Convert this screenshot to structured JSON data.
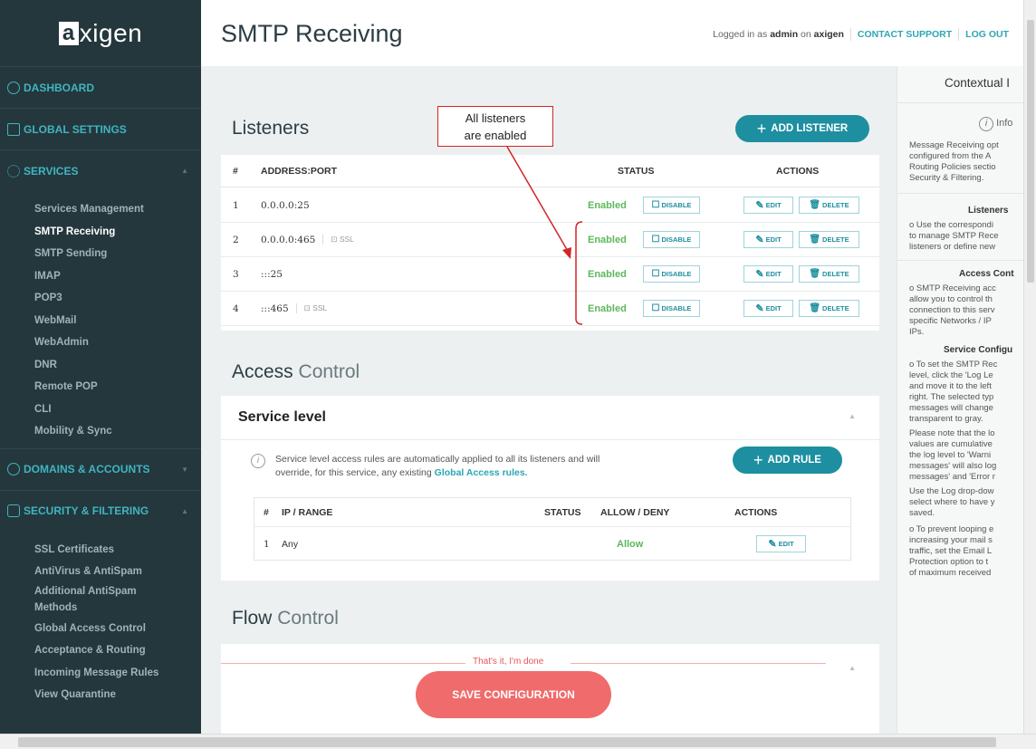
{
  "app": {
    "logo_box": "a",
    "logo_rest": "xigen"
  },
  "header": {
    "title": "SMTP Receiving",
    "logged_prefix": "Logged in as",
    "user": "admin",
    "on_word": "on",
    "host": "axigen",
    "contact_support": "CONTACT SUPPORT",
    "logout": "LOG OUT"
  },
  "sidebar": {
    "dashboard": "DASHBOARD",
    "global_settings": "GLOBAL SETTINGS",
    "services": "SERVICES",
    "services_items": [
      "Services Management",
      "SMTP Receiving",
      "SMTP Sending",
      "IMAP",
      "POP3",
      "WebMail",
      "WebAdmin",
      "DNR",
      "Remote POP",
      "CLI",
      "Mobility & Sync"
    ],
    "domains": "DOMAINS & ACCOUNTS",
    "security": "SECURITY & FILTERING",
    "security_items": [
      "SSL Certificates",
      "AntiVirus & AntiSpam",
      "Additional AntiSpam",
      "Methods",
      "Global Access Control",
      "Acceptance & Routing",
      "Incoming Message Rules",
      "View Quarantine"
    ]
  },
  "listeners": {
    "title": "Listeners",
    "add_label": "ADD LISTENER",
    "col_num": "#",
    "col_address": "ADDRESS:PORT",
    "col_status": "STATUS",
    "col_actions": "ACTIONS",
    "ssl_label": "SSL",
    "disable_label": "DISABLE",
    "edit_label": "EDIT",
    "delete_label": "DELETE",
    "rows": [
      {
        "num": "1",
        "address": "0.0.0.0:25",
        "ssl": false,
        "status": "Enabled"
      },
      {
        "num": "2",
        "address": "0.0.0.0:465",
        "ssl": true,
        "status": "Enabled"
      },
      {
        "num": "3",
        "address": ":::25",
        "ssl": false,
        "status": "Enabled"
      },
      {
        "num": "4",
        "address": ":::465",
        "ssl": true,
        "status": "Enabled"
      }
    ]
  },
  "callout": {
    "line1": "All listeners",
    "line2": "are enabled"
  },
  "access": {
    "title_bold": "Access",
    "title_light": "Control",
    "service_level": "Service level",
    "info_text_1": "Service level access rules are automatically applied to all its listeners and will",
    "info_text_2": "override, for this service, any existing",
    "info_link": "Global Access rules.",
    "add_rule": "ADD RULE",
    "col_num": "#",
    "col_ip": "IP / RANGE",
    "col_status": "STATUS",
    "col_allow": "ALLOW / DENY",
    "col_actions": "ACTIONS",
    "rows": [
      {
        "num": "1",
        "ip": "Any",
        "allow": "Allow"
      }
    ],
    "edit_label": "EDIT"
  },
  "flow": {
    "title_bold": "Flow",
    "title_light": "Control"
  },
  "footer": {
    "done_text": "That's it, I'm done",
    "save_label": "SAVE CONFIGURATION"
  },
  "context": {
    "title": "Contextual I",
    "info": "Info",
    "lines1": [
      "Message Receiving opt",
      "configured from the A",
      "Routing Policies sectio",
      "Security & Filtering."
    ],
    "listeners_title": "Listeners",
    "listeners_lines": [
      "o  Use the correspondi",
      "to manage SMTP Rece",
      "listeners or define new"
    ],
    "access_title": "Access Cont",
    "access_lines": [
      "o  SMTP Receiving acc",
      "allow you to control th",
      "connection to this serv",
      "specific Networks / IP",
      "IPs."
    ],
    "service_title": "Service Configu",
    "service_lines": [
      "o  To set the SMTP Rec",
      "level, click the 'Log Le",
      "and move it to the left",
      "right. The selected typ",
      "messages will change",
      "transparent to gray."
    ],
    "note_lines": [
      "Please note that the lo",
      "values are cumulative",
      "the log level to 'Warni",
      "messages' will also log",
      "messages' and 'Error r"
    ],
    "log_lines": [
      "Use the Log drop-dow",
      "select where to have y",
      "saved."
    ],
    "loop_lines": [
      "o  To prevent looping e",
      "increasing your mail s",
      "traffic, set the Email L",
      "Protection option to t",
      "of maximum received"
    ]
  },
  "colors": {
    "sidebar_bg": "#24373d",
    "accent": "#1d8fa0",
    "link": "#2aa7b3",
    "enabled": "#5cb85c",
    "save": "#f06b6b",
    "callout": "#d32525"
  }
}
